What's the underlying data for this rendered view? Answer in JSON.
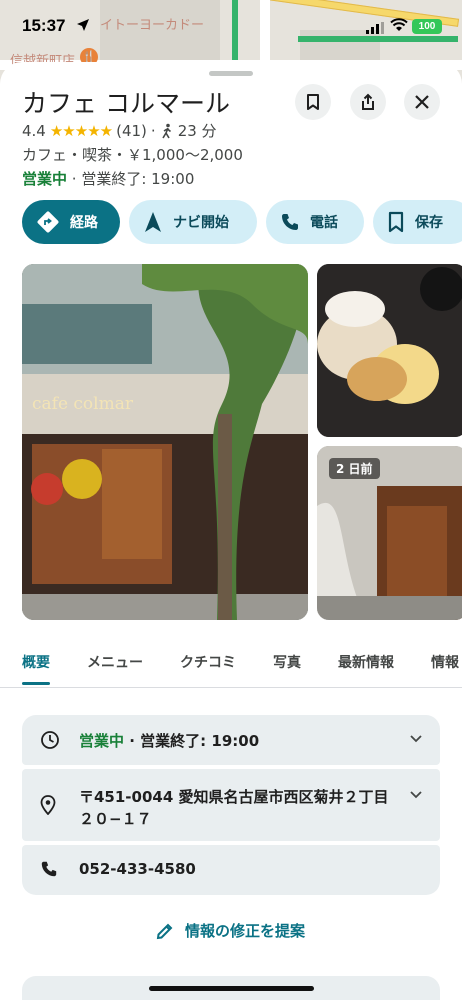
{
  "status_bar": {
    "time": "15:37",
    "battery": "100"
  },
  "map": {
    "label_top": "イトーヨーカドー",
    "label_store": "信越新町店"
  },
  "place": {
    "title": "カフェ コルマール",
    "rating": "4.4",
    "stars": "★★★★★",
    "review_count": "(41)",
    "walk_sep": "·",
    "walk_time": "23 分",
    "category_price": "カフェ・喫茶・￥1,000～2,000",
    "open_status": "営業中",
    "hours_text": " · 営業終了: 19:00"
  },
  "actions": [
    {
      "label": "経路",
      "icon": "directions-icon"
    },
    {
      "label": "ナビ開始",
      "icon": "navigation-arrow-icon"
    },
    {
      "label": "電話",
      "icon": "phone-icon"
    },
    {
      "label": "保存",
      "icon": "bookmark-icon"
    }
  ],
  "photos": {
    "side_badge": "2 日前",
    "storefront_sign": "cafe colmar"
  },
  "tabs": [
    "概要",
    "メニュー",
    "クチコミ",
    "写真",
    "最新情報",
    "情報"
  ],
  "info": {
    "hours_open": "営業中",
    "hours_rest": " · 営業終了: 19:00",
    "address_line1": "〒451-0044 愛知県名古屋市西区菊井２丁目",
    "address_line2": "２０−１７",
    "phone": "052-433-4580"
  },
  "suggest_edit": "情報の修正を提案",
  "colors": {
    "accent": "#0b7285",
    "chip_bg": "#d3eef7",
    "open_green": "#188038",
    "card_bg": "#e9eef0"
  }
}
